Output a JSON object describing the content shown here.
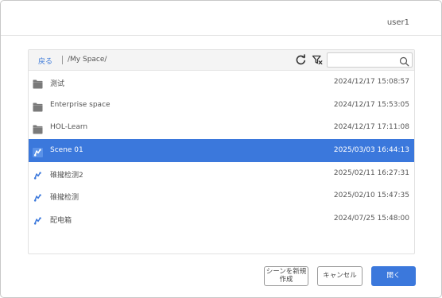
{
  "header": {
    "user": "user1"
  },
  "toolbar": {
    "back_label": "戻る",
    "path": "/My Space/",
    "search_placeholder": "",
    "icons": [
      "refresh-icon",
      "filter-icon",
      "search-icon"
    ]
  },
  "files": [
    {
      "type": "folder",
      "icon": "folder-icon",
      "name": "測试",
      "date": "2024/12/17 15:08:57",
      "selected": false
    },
    {
      "type": "folder",
      "icon": "folder-icon",
      "name": "Enterprise space",
      "date": "2024/12/17 15:53:05",
      "selected": false
    },
    {
      "type": "folder",
      "icon": "folder-icon",
      "name": "HOL-Learn",
      "date": "2024/12/17 17:11:08",
      "selected": false
    },
    {
      "type": "scene",
      "icon": "scene-icon",
      "name": "Scene 01",
      "date": "2025/03/03 16:44:13",
      "selected": true
    },
    {
      "type": "scene",
      "icon": "scene-icon",
      "name": "碓攏检测2",
      "date": "2025/02/11 16:27:31",
      "selected": false
    },
    {
      "type": "scene",
      "icon": "scene-icon",
      "name": "碓攏检测",
      "date": "2025/02/10 15:47:35",
      "selected": false
    },
    {
      "type": "scene",
      "icon": "scene-icon",
      "name": "配电箱",
      "date": "2024/07/25 15:48:00",
      "selected": false
    }
  ],
  "buttons": {
    "new_scene": "シーンを新規\n作成",
    "cancel": "キャンセル",
    "open": "開く"
  },
  "colors": {
    "accent": "#3b78dc",
    "link": "#3a78d8",
    "folder_icon": "#7a7a7a"
  }
}
